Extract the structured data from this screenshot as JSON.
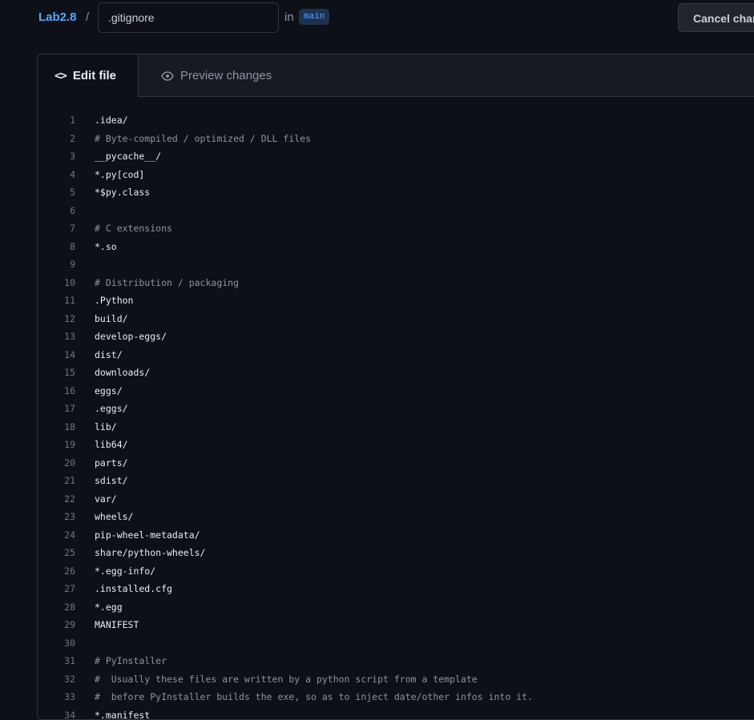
{
  "header": {
    "repo": "Lab2.8",
    "separator": "/",
    "filename": ".gitignore",
    "in_label": "in",
    "branch": "main",
    "cancel_label": "Cancel changes"
  },
  "tabs": {
    "edit": "Edit file",
    "preview": "Preview changes"
  },
  "icons": {
    "edit_tab": "code-icon",
    "preview_tab": "eye-icon"
  },
  "code_lines": [
    {
      "n": "1",
      "text": ".idea/",
      "comment": false
    },
    {
      "n": "2",
      "text": "# Byte-compiled / optimized / DLL files",
      "comment": true
    },
    {
      "n": "3",
      "text": "__pycache__/",
      "comment": false
    },
    {
      "n": "4",
      "text": "*.py[cod]",
      "comment": false
    },
    {
      "n": "5",
      "text": "*$py.class",
      "comment": false
    },
    {
      "n": "6",
      "text": "",
      "comment": false
    },
    {
      "n": "7",
      "text": "# C extensions",
      "comment": true
    },
    {
      "n": "8",
      "text": "*.so",
      "comment": false
    },
    {
      "n": "9",
      "text": "",
      "comment": false
    },
    {
      "n": "10",
      "text": "# Distribution / packaging",
      "comment": true
    },
    {
      "n": "11",
      "text": ".Python",
      "comment": false
    },
    {
      "n": "12",
      "text": "build/",
      "comment": false
    },
    {
      "n": "13",
      "text": "develop-eggs/",
      "comment": false
    },
    {
      "n": "14",
      "text": "dist/",
      "comment": false
    },
    {
      "n": "15",
      "text": "downloads/",
      "comment": false
    },
    {
      "n": "16",
      "text": "eggs/",
      "comment": false
    },
    {
      "n": "17",
      "text": ".eggs/",
      "comment": false
    },
    {
      "n": "18",
      "text": "lib/",
      "comment": false
    },
    {
      "n": "19",
      "text": "lib64/",
      "comment": false
    },
    {
      "n": "20",
      "text": "parts/",
      "comment": false
    },
    {
      "n": "21",
      "text": "sdist/",
      "comment": false
    },
    {
      "n": "22",
      "text": "var/",
      "comment": false
    },
    {
      "n": "23",
      "text": "wheels/",
      "comment": false
    },
    {
      "n": "24",
      "text": "pip-wheel-metadata/",
      "comment": false
    },
    {
      "n": "25",
      "text": "share/python-wheels/",
      "comment": false
    },
    {
      "n": "26",
      "text": "*.egg-info/",
      "comment": false
    },
    {
      "n": "27",
      "text": ".installed.cfg",
      "comment": false
    },
    {
      "n": "28",
      "text": "*.egg",
      "comment": false
    },
    {
      "n": "29",
      "text": "MANIFEST",
      "comment": false
    },
    {
      "n": "30",
      "text": "",
      "comment": false
    },
    {
      "n": "31",
      "text": "# PyInstaller",
      "comment": true
    },
    {
      "n": "32",
      "text": "#  Usually these files are written by a python script from a template",
      "comment": true
    },
    {
      "n": "33",
      "text": "#  before PyInstaller builds the exe, so as to inject date/other infos into it.",
      "comment": true
    },
    {
      "n": "34",
      "text": "*.manifest",
      "comment": false
    }
  ]
}
